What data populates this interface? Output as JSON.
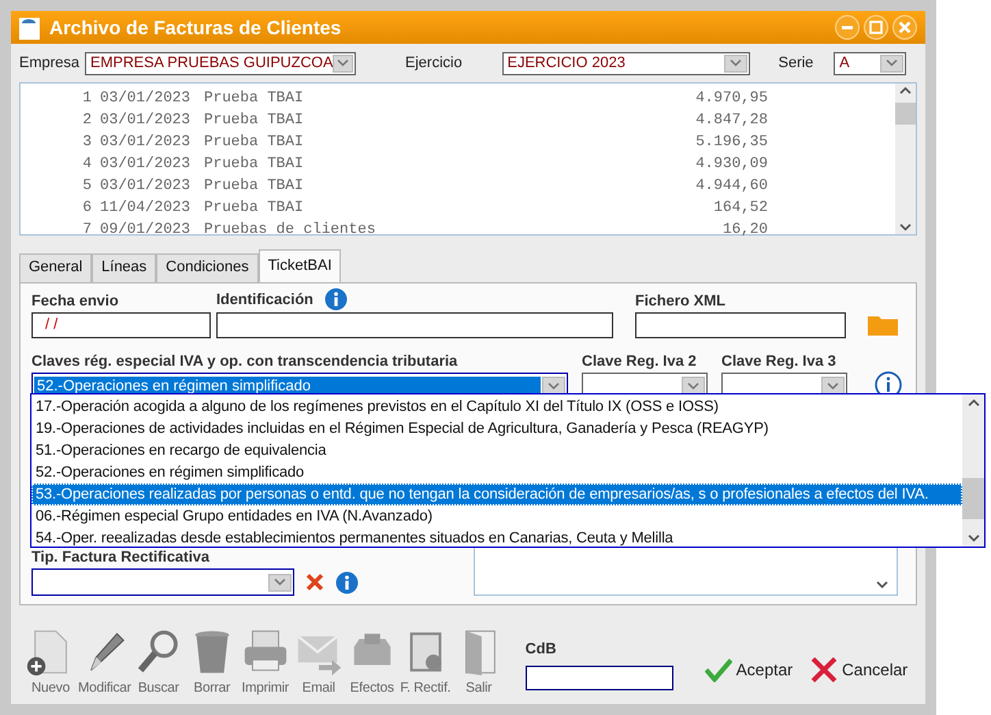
{
  "window": {
    "title": "Archivo de Facturas de Clientes"
  },
  "header": {
    "empresa": {
      "label": "Empresa",
      "value": "EMPRESA PRUEBAS GUIPUZCOA"
    },
    "ejercicio": {
      "label": "Ejercicio",
      "value": "EJERCICIO 2023"
    },
    "serie": {
      "label": "Serie",
      "value": "A"
    }
  },
  "invoices": [
    {
      "number": "1",
      "date": "03/01/2023",
      "description": "Prueba TBAI",
      "amount": "4.970,95"
    },
    {
      "number": "2",
      "date": "03/01/2023",
      "description": "Prueba TBAI",
      "amount": "4.847,28"
    },
    {
      "number": "3",
      "date": "03/01/2023",
      "description": "Prueba TBAI",
      "amount": "5.196,35"
    },
    {
      "number": "4",
      "date": "03/01/2023",
      "description": "Prueba TBAI",
      "amount": "4.930,09"
    },
    {
      "number": "5",
      "date": "03/01/2023",
      "description": "Prueba TBAI",
      "amount": "4.944,60"
    },
    {
      "number": "6",
      "date": "11/04/2023",
      "description": "Prueba TBAI",
      "amount": "164,52"
    },
    {
      "number": "7",
      "date": "09/01/2023",
      "description": "Pruebas de clientes",
      "amount": "16,20"
    }
  ],
  "tabs": [
    {
      "label": "General",
      "selected": false
    },
    {
      "label": "Líneas",
      "selected": false
    },
    {
      "label": "Condiciones",
      "selected": false
    },
    {
      "label": "TicketBAI",
      "selected": true
    }
  ],
  "ticketbai": {
    "fecha_envio": {
      "label": "Fecha envio",
      "value": " / /"
    },
    "identificacion": {
      "label": "Identificación"
    },
    "fichero_xml": {
      "label": "Fichero XML"
    },
    "claves": {
      "label": "Claves rég. especial IVA y op. con transcendencia tributaria",
      "value": "52.-Operaciones en régimen simplificado"
    },
    "clave_reg_iva_2": {
      "label": "Clave Reg. Iva 2"
    },
    "clave_reg_iva_3": {
      "label": "Clave Reg. Iva 3"
    },
    "tip_factura_rectificativa": {
      "label": "Tip. Factura Rectificativa"
    }
  },
  "dropdown_options": [
    {
      "label": "17.-Operación acogida a alguno de los regímenes previstos en el Capítulo XI del Título IX (OSS e IOSS)",
      "selected": false
    },
    {
      "label": "19.-Operaciones de actividades incluidas en el Régimen Especial de Agricultura, Ganadería y Pesca (REAGYP)",
      "selected": false
    },
    {
      "label": "51.-Operaciones en recargo de equivalencia",
      "selected": false
    },
    {
      "label": "52.-Operaciones en régimen simplificado",
      "selected": false
    },
    {
      "label": "53.-Operaciones realizadas por personas o entd. que no tengan la consideración de empresarios/as, s o profesionales a efectos del IVA.",
      "selected": true
    },
    {
      "label": "06.-Régimen especial Grupo entidades en IVA (N.Avanzado)",
      "selected": false
    },
    {
      "label": "54.-Oper. reealizadas desde establecimientos permanentes situados en Canarias, Ceuta y Melilla",
      "selected": false
    }
  ],
  "toolbar": [
    {
      "label": "Nuevo"
    },
    {
      "label": "Modificar"
    },
    {
      "label": "Buscar"
    },
    {
      "label": "Borrar"
    },
    {
      "label": "Imprimir"
    },
    {
      "label": "Email"
    },
    {
      "label": "Efectos"
    },
    {
      "label": "F. Rectif."
    },
    {
      "label": "Salir"
    }
  ],
  "cdb": {
    "label": "CdB"
  },
  "buttons": {
    "accept": "Aceptar",
    "cancel": "Cancelar"
  }
}
